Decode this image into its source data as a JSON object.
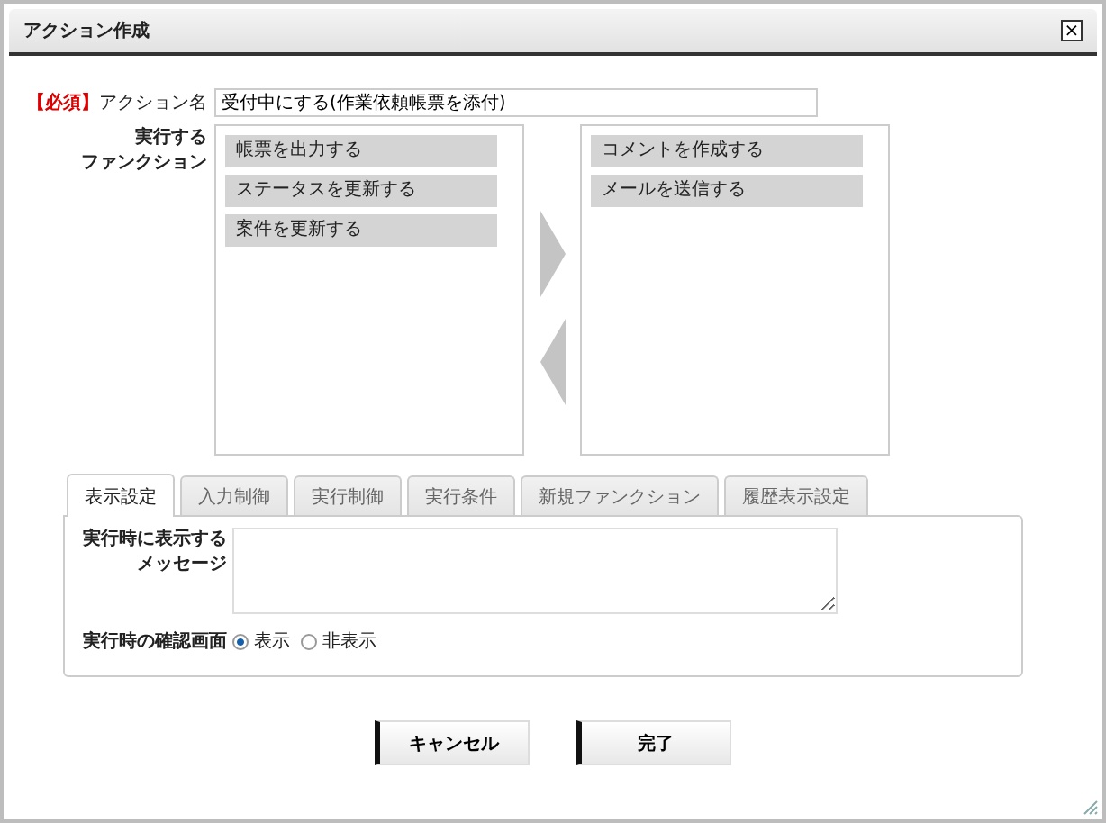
{
  "window": {
    "title": "アクション作成",
    "close": "×"
  },
  "action_name": {
    "required": "【必須】",
    "label": "アクション名",
    "value": "受付中にする(作業依頼帳票を添付)"
  },
  "functions": {
    "label_lines": [
      "実行する",
      "ファンクション"
    ],
    "available": [
      "帳票を出力する",
      "ステータスを更新する",
      "案件を更新する"
    ],
    "selected_items": [
      "コメントを作成する",
      "メールを送信する"
    ]
  },
  "tabs": [
    {
      "label": "表示設定",
      "selected": true
    },
    {
      "label": "入力制御",
      "selected": false
    },
    {
      "label": "実行制御",
      "selected": false
    },
    {
      "label": "実行条件",
      "selected": false
    },
    {
      "label": "新規ファンクション",
      "selected": false
    },
    {
      "label": "履歴表示設定",
      "selected": false
    }
  ],
  "message": {
    "label_lines": [
      "実行時に表示する",
      "メッセージ"
    ]
  },
  "confirm": {
    "label": "実行時の確認画面",
    "options": [
      {
        "label": "表示",
        "selected": true
      },
      {
        "label": "非表示",
        "selected": false
      }
    ]
  },
  "buttons": [
    "キャンセル",
    "完了"
  ]
}
